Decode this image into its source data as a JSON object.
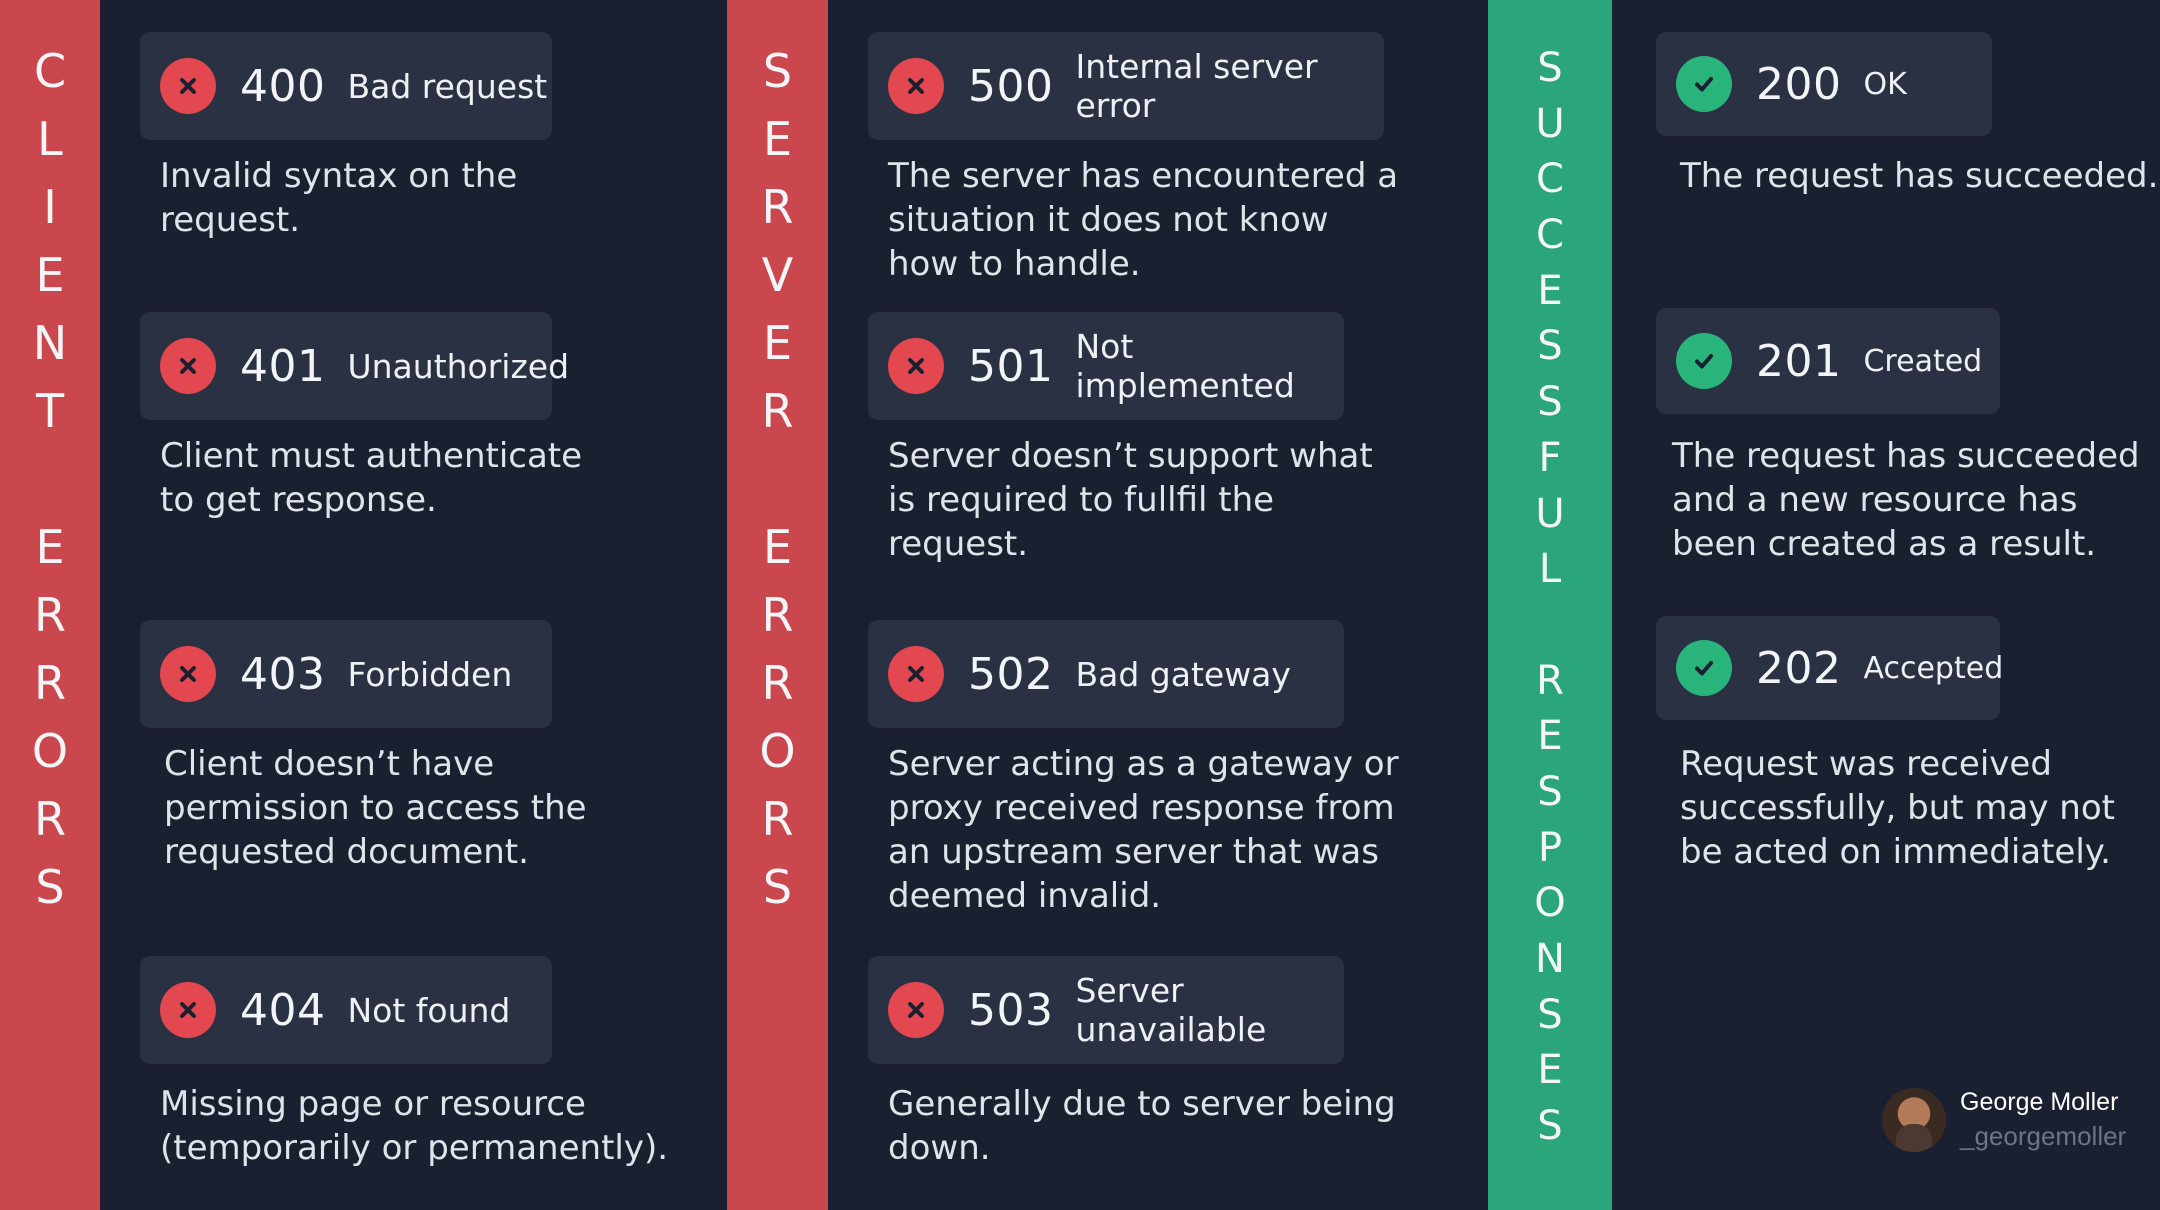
{
  "colors": {
    "background": "#1b2030",
    "card": "#2a3142",
    "error_band": "#c9474d",
    "success_band": "#2ba67a",
    "error_badge": "#e3474f",
    "success_badge": "#28b47b"
  },
  "bands": {
    "client": "CLIENT ERRORS",
    "server": "SERVER ERRORS",
    "success": "SUCCESSFUL RESPONSES"
  },
  "client_errors": [
    {
      "code": "400",
      "label": "Bad request",
      "icon": "error-x-icon",
      "description": "Invalid syntax on the\nrequest."
    },
    {
      "code": "401",
      "label": "Unauthorized",
      "icon": "error-x-icon",
      "description": "Client must authenticate\nto get response."
    },
    {
      "code": "403",
      "label": "Forbidden",
      "icon": "error-x-icon",
      "description": "Client doesn’t have\npermission to access the\nrequested document."
    },
    {
      "code": "404",
      "label": "Not found",
      "icon": "error-x-icon",
      "description": "Missing page or resource\n(temporarily or permanently)."
    }
  ],
  "server_errors": [
    {
      "code": "500",
      "label": "Internal server error",
      "icon": "error-x-icon",
      "description": "The server has encountered a\nsituation it does not know\nhow to handle."
    },
    {
      "code": "501",
      "label": "Not implemented",
      "icon": "error-x-icon",
      "description": "Server doesn’t support what\nis required to fullfil the\nrequest."
    },
    {
      "code": "502",
      "label": "Bad gateway",
      "icon": "error-x-icon",
      "description": "Server acting as a gateway or\nproxy received response from\nan upstream server that was\ndeemed invalid."
    },
    {
      "code": "503",
      "label": "Server unavailable",
      "icon": "error-x-icon",
      "description": "Generally due to server being\ndown."
    }
  ],
  "success_responses": [
    {
      "code": "200",
      "label": "OK",
      "icon": "check-icon",
      "description": "The request has succeeded."
    },
    {
      "code": "201",
      "label": "Created",
      "icon": "check-icon",
      "description": "The request has succeeded\nand a new resource has\nbeen created as a result."
    },
    {
      "code": "202",
      "label": "Accepted",
      "icon": "check-icon",
      "description": "Request was received\nsuccessfully, but may not\nbe acted on immediately."
    }
  ],
  "author": {
    "name": "George Moller",
    "handle": "_georgemoller"
  }
}
